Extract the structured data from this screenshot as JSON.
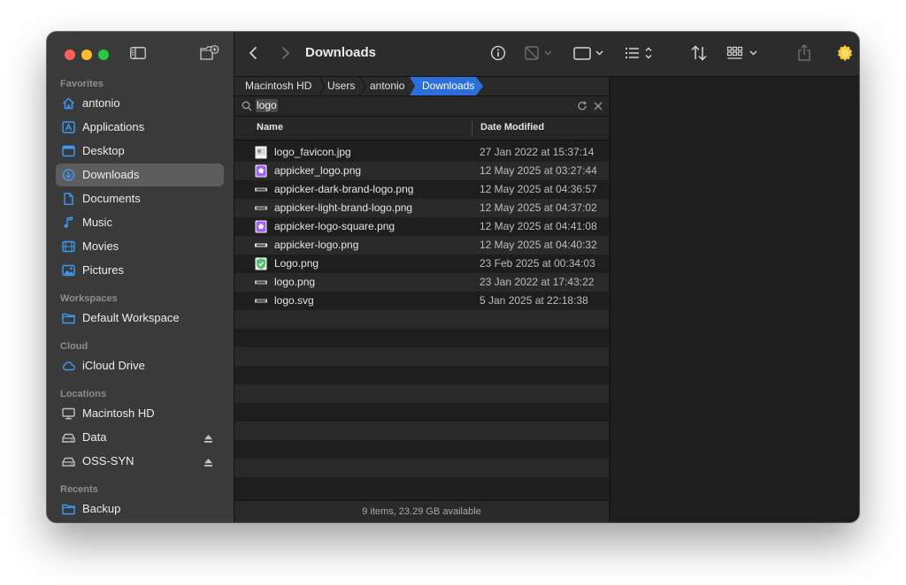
{
  "sidebar": {
    "sections": [
      {
        "title": "Favorites",
        "items": [
          {
            "label": "antonio",
            "icon": "home-icon"
          },
          {
            "label": "Applications",
            "icon": "applications-icon"
          },
          {
            "label": "Desktop",
            "icon": "desktop-icon"
          },
          {
            "label": "Downloads",
            "icon": "downloads-icon",
            "selected": true
          },
          {
            "label": "Documents",
            "icon": "document-icon"
          },
          {
            "label": "Music",
            "icon": "music-icon"
          },
          {
            "label": "Movies",
            "icon": "movies-icon"
          },
          {
            "label": "Pictures",
            "icon": "pictures-icon"
          }
        ]
      },
      {
        "title": "Workspaces",
        "items": [
          {
            "label": "Default Workspace",
            "icon": "folder-icon"
          }
        ]
      },
      {
        "title": "Cloud",
        "items": [
          {
            "label": "iCloud Drive",
            "icon": "cloud-icon"
          }
        ]
      },
      {
        "title": "Locations",
        "items": [
          {
            "label": "Macintosh HD",
            "icon": "computer-icon"
          },
          {
            "label": "Data",
            "icon": "drive-icon",
            "ejectable": true
          },
          {
            "label": "OSS-SYN",
            "icon": "drive-icon",
            "ejectable": true
          }
        ]
      },
      {
        "title": "Recents",
        "items": [
          {
            "label": "Backup",
            "icon": "folder-icon"
          }
        ]
      }
    ]
  },
  "toolbar": {
    "title": "Downloads",
    "icons": [
      "back-icon",
      "forward-icon",
      "info-icon",
      "tag-icon",
      "window-icon",
      "list-view-icon",
      "sort-icon",
      "group-icon",
      "share-icon",
      "avatar-icon"
    ]
  },
  "breadcrumb": [
    "Macintosh HD",
    "Users",
    "antonio",
    "Downloads"
  ],
  "search": {
    "query": "logo"
  },
  "columns": {
    "name": "Name",
    "date": "Date Modified"
  },
  "files": [
    {
      "name": "logo_favicon.jpg",
      "date": "27 Jan 2022 at 15:37:14",
      "icon": "jpg-file-icon",
      "color": "#ffffff"
    },
    {
      "name": "appicker_logo.png",
      "date": "12 May 2025 at 03:27:44",
      "icon": "png-purple-logo-icon",
      "color": "#a361f7"
    },
    {
      "name": "appicker-dark-brand-logo.png",
      "date": "12 May 2025 at 04:36:57",
      "icon": "png-banner-icon",
      "color": "#bfbfbf"
    },
    {
      "name": "appicker-light-brand-logo.png",
      "date": "12 May 2025 at 04:37:02",
      "icon": "png-banner-icon",
      "color": "#bfbfbf"
    },
    {
      "name": "appicker-logo-square.png",
      "date": "12 May 2025 at 04:41:08",
      "icon": "png-purple-logo-icon",
      "color": "#a361f7"
    },
    {
      "name": "appicker-logo.png",
      "date": "12 May 2025 at 04:40:32",
      "icon": "png-banner-icon",
      "color": "#e6e6e6"
    },
    {
      "name": "Logo.png",
      "date": "23 Feb 2025 at 00:34:03",
      "icon": "png-shield-icon",
      "color": "#56c16c"
    },
    {
      "name": "logo.png",
      "date": "23 Jan 2022 at 17:43:22",
      "icon": "png-banner-icon",
      "color": "#bfbfbf"
    },
    {
      "name": "logo.svg",
      "date": "5 Jan 2025 at 22:18:38",
      "icon": "svg-file-icon",
      "color": "#bfbfbf"
    }
  ],
  "status": "9 items, 23.29 GB available",
  "colors": {
    "accent": "#2c6fdb",
    "window": "#1e1e1e",
    "sidebar": "#3a3a3a",
    "toolbar": "#2c2c2c",
    "stripe": "#2a2a2a",
    "sidebarIcon": "#3a9bf5"
  }
}
